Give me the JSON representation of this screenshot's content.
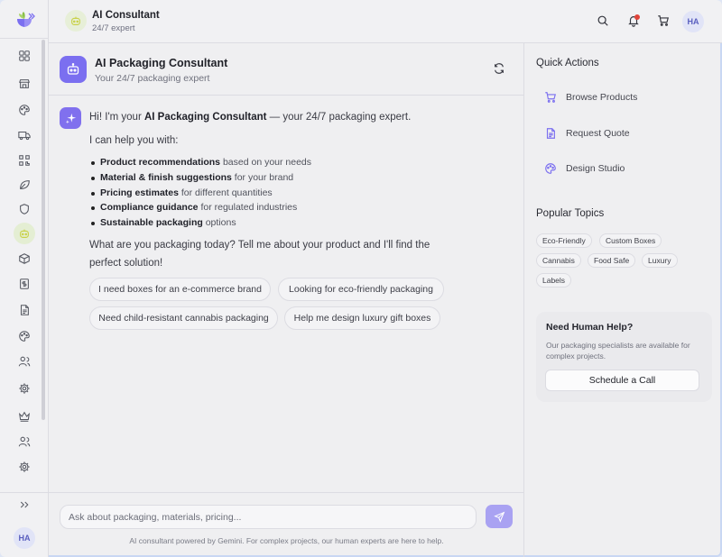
{
  "header": {
    "title": "AI Consultant",
    "subtitle": "24/7 expert",
    "avatar_initials": "HA"
  },
  "rail": {
    "items": [
      "dashboard-icon",
      "store-icon",
      "palette-icon",
      "truck-icon",
      "qr-code-icon",
      "leaf-icon",
      "shield-icon",
      "consultant-icon",
      "box-icon",
      "dollar-document-icon",
      "document-icon",
      "palette-icon",
      "users-icon",
      "settings-icon",
      "crown-icon",
      "users-icon",
      "settings-icon"
    ],
    "active_item": "consultant-icon",
    "avatar_initials": "HA"
  },
  "chat": {
    "title": "AI Packaging Consultant",
    "subtitle": "Your 24/7 packaging expert",
    "message": {
      "greeting_prefix": "Hi! I'm your ",
      "greeting_bold": "AI Packaging Consultant",
      "greeting_suffix": " — your 24/7 packaging expert.",
      "help_intro": "I can help you with:",
      "capabilities": [
        {
          "bold": "Product recommendations",
          "rest": " based on your needs"
        },
        {
          "bold": "Material & finish suggestions",
          "rest": " for your brand"
        },
        {
          "bold": "Pricing estimates",
          "rest": " for different quantities"
        },
        {
          "bold": "Compliance guidance",
          "rest": " for regulated industries"
        },
        {
          "bold": "Sustainable packaging",
          "rest": " options"
        }
      ],
      "question": "What are you packaging today? Tell me about your product and I'll find the perfect solution!"
    },
    "suggestions": [
      "I need boxes for an e-commerce brand",
      "Looking for eco-friendly packaging",
      "Need child-resistant cannabis packaging",
      "Help me design luxury gift boxes"
    ],
    "input_placeholder": "Ask about packaging, materials, pricing...",
    "footer_note": "AI consultant powered by Gemini. For complex projects, our human experts are here to help."
  },
  "right_panel": {
    "quick_actions_title": "Quick Actions",
    "quick_actions": [
      "Browse Products",
      "Request Quote",
      "Design Studio"
    ],
    "popular_topics_title": "Popular Topics",
    "topics": [
      "Eco-Friendly",
      "Custom Boxes",
      "Cannabis",
      "Food Safe",
      "Luxury",
      "Labels"
    ],
    "help": {
      "title": "Need Human Help?",
      "description": "Our packaging specialists are available for complex projects.",
      "button": "Schedule a Call"
    }
  },
  "colors": {
    "accent": "#7b6ff0",
    "send_button": "#a9a2f2",
    "notification_dot": "#e0443a",
    "active_rail": "#e4eed3"
  }
}
